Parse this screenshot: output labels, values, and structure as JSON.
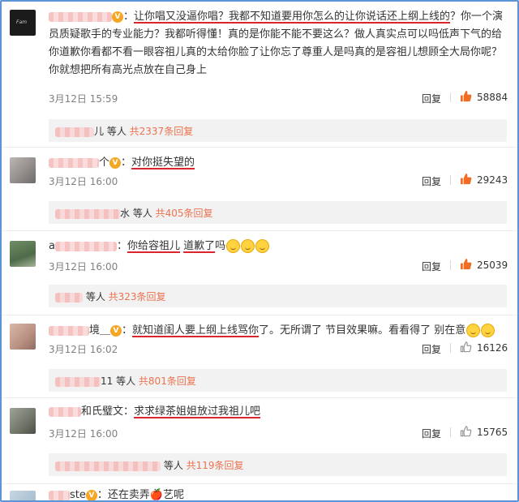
{
  "comments": [
    {
      "username": "",
      "text_pre": "：",
      "text_hl1": "让你唱又没逼你唱？",
      "text_hl2": "我都不知道要用你怎么的让你说话还上纲上线的",
      "text_rest": "？你一个演员质疑歌手的专业能力？我都听得懂！真的是你能不能不要这么？做人真实点可以吗低声下气的给你道歉你看都不看一眼容祖儿真的太给你脸了让你忘了尊重人是吗真的是容祖儿想顾全大局你呢？你就想把所有高光点放在自己身上",
      "avatar_text": "Fam",
      "time": "3月12日 15:59",
      "reply_label": "回复",
      "likes": "58884",
      "thumb_color": "#f06d23",
      "sub_name": "儿",
      "sub_text_a": " 等人 ",
      "sub_more": "共2337条回复"
    },
    {
      "username": "个",
      "text_hl1": "对你挺失望的",
      "time": "3月12日 16:00",
      "reply_label": "回复",
      "likes": "29243",
      "thumb_color": "#f06d23",
      "sub_name": "水",
      "sub_text_a": " 等人 ",
      "sub_more": "共405条回复"
    },
    {
      "username": "a",
      "text_hl1": "你给容祖儿",
      "text_hl2": "道歉了",
      "text_rest": "吗",
      "time": "3月12日 16:00",
      "reply_label": "回复",
      "likes": "25039",
      "thumb_color": "#f06d23",
      "sub_name": "",
      "sub_text_a": " 等人 ",
      "sub_more": "共323条回复"
    },
    {
      "username": "境＿",
      "text_hl1": "就知道闺人要上纲上线骂你",
      "text_rest": "了。无所谓了 节目效果嘛。看看得了 别在意",
      "time": "3月12日 16:02",
      "reply_label": "回复",
      "likes": "16126",
      "thumb_color": "#888888",
      "sub_name": "11",
      "sub_text_a": " 等人 ",
      "sub_more": "共801条回复"
    },
    {
      "username": "和氏璧文",
      "text_hl1": "求求绿茶姐姐放过我祖儿吧",
      "time": "3月12日 16:00",
      "reply_label": "回复",
      "likes": "15765",
      "thumb_color": "#888888",
      "sub_name": "",
      "sub_text_a": " 等人 ",
      "sub_more": "共119条回复"
    },
    {
      "username": "ste",
      "text_hl1": "还在卖弄",
      "text_mid": "🍎",
      "text_hl2": "艺呢"
    }
  ]
}
